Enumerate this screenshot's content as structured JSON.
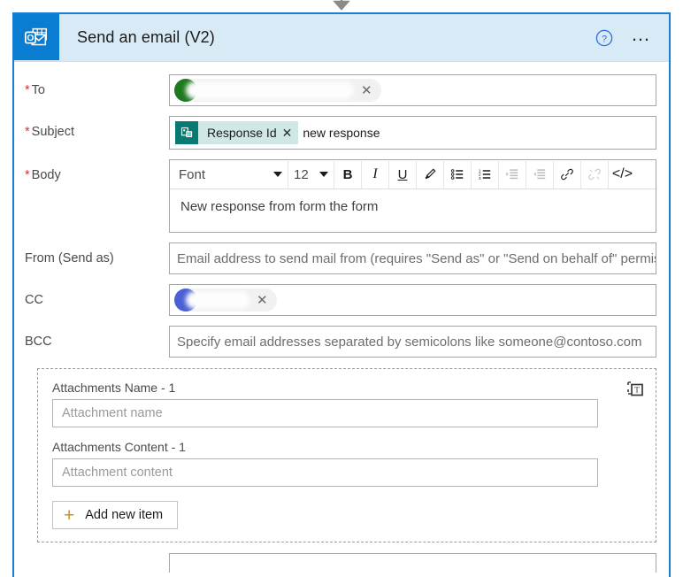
{
  "connector": {
    "icon": "arrow-down-icon"
  },
  "header": {
    "app_icon": "outlook-icon",
    "title": "Send an email (V2)",
    "help_icon": "help-circle-icon",
    "more_icon": "…",
    "more_label": "more-options-icon",
    "accent_color": "#0a7cd2",
    "band_color": "#d9eaf7"
  },
  "fields": {
    "to": {
      "label": "To",
      "required": true,
      "chip": {
        "name": "",
        "avatar_color": "#1f7a1f",
        "remove": "✕"
      }
    },
    "subject": {
      "label": "Subject",
      "required": true,
      "token": {
        "label": "Response Id",
        "icon": "microsoft-forms-icon",
        "remove": "✕",
        "color": "#087a72"
      },
      "text": "new response"
    },
    "body": {
      "label": "Body",
      "required": true,
      "toolbar": {
        "font": "Font",
        "size": "12",
        "bold": "B",
        "italic": "I",
        "underline": "U",
        "highlight_icon": "highlighter-icon",
        "bulleted_icon": "bulleted-list-icon",
        "numbered_icon": "numbered-list-icon",
        "indent_icon": "indent-icon",
        "outdent_icon": "outdent-icon",
        "link_icon": "link-icon",
        "unlink_icon": "unlink-icon",
        "code_icon": "code-view-icon",
        "code_glyph": "</>"
      },
      "content": "New response from form the form"
    },
    "from": {
      "label": "From (Send as)",
      "required": false,
      "placeholder": "Email address to send mail from (requires \"Send as\" or \"Send on behalf of\" permissions)"
    },
    "cc": {
      "label": "CC",
      "required": false,
      "chip": {
        "name": "",
        "avatar_color": "#4b5fd6",
        "remove": "✕"
      }
    },
    "bcc": {
      "label": "BCC",
      "required": false,
      "placeholder": "Specify email addresses separated by semicolons like someone@contoso.com"
    }
  },
  "attachments": {
    "toggle_icon": "switch-to-text-mode-icon",
    "name_label": "Attachments Name - 1",
    "name_placeholder": "Attachment name",
    "content_label": "Attachments Content - 1",
    "content_placeholder": "Attachment content",
    "add_button": "Add new item",
    "add_plus": "+"
  }
}
